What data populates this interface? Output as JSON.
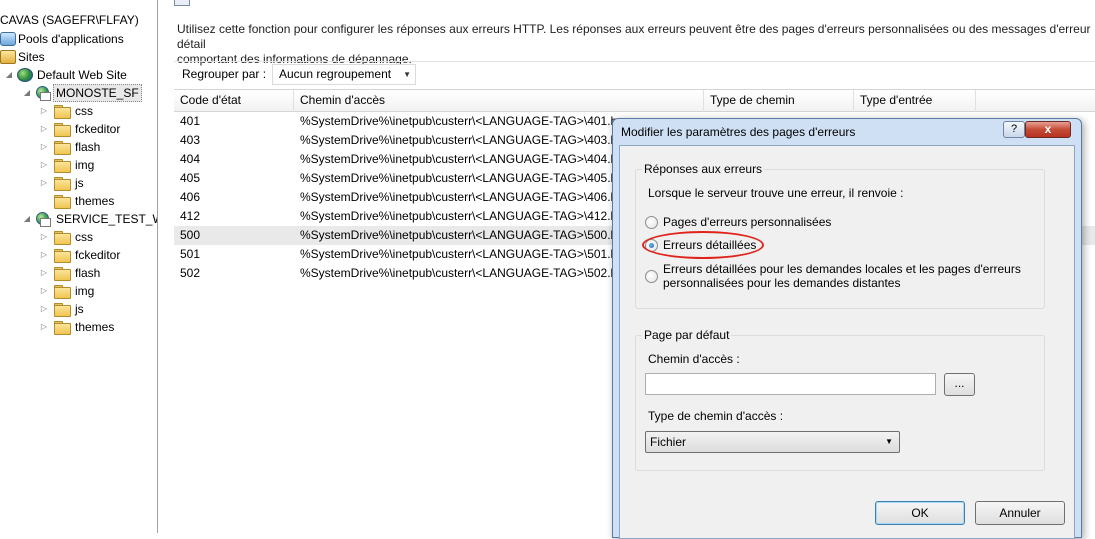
{
  "tree": {
    "items": [
      {
        "label": "CAVAS (SAGEFR\\FLFAY)",
        "icon": "server-icon"
      },
      {
        "label": "Pools d'applications",
        "icon": "app-pool-icon"
      },
      {
        "label": "Sites",
        "icon": "sites-icon"
      },
      {
        "label": "Default Web Site",
        "icon": "globe-icon"
      },
      {
        "label": "MONOSTE_SF",
        "icon": "site-icon"
      },
      {
        "label": "css",
        "icon": "folder-icon"
      },
      {
        "label": "fckeditor",
        "icon": "folder-icon"
      },
      {
        "label": "flash",
        "icon": "folder-icon"
      },
      {
        "label": "img",
        "icon": "folder-icon"
      },
      {
        "label": "js",
        "icon": "folder-icon"
      },
      {
        "label": "themes",
        "icon": "folder-icon"
      },
      {
        "label": "SERVICE_TEST_WSI",
        "icon": "site-icon"
      },
      {
        "label": "css",
        "icon": "folder-icon"
      },
      {
        "label": "fckeditor",
        "icon": "folder-icon"
      },
      {
        "label": "flash",
        "icon": "folder-icon"
      },
      {
        "label": "img",
        "icon": "folder-icon"
      },
      {
        "label": "js",
        "icon": "folder-icon"
      },
      {
        "label": "themes",
        "icon": "folder-icon"
      }
    ]
  },
  "main": {
    "description_line1": "Utilisez cette fonction pour configurer les réponses aux erreurs HTTP. Les réponses aux erreurs peuvent être des pages d'erreurs personnalisées ou des messages d'erreur détail",
    "description_line2": "comportant des informations de dépannage.",
    "group_by_label": "Regrouper par :",
    "group_by_value": "Aucun regroupement",
    "columns": [
      "Code d'état",
      "Chemin d'accès",
      "Type de chemin",
      "Type d'entrée"
    ],
    "rows": [
      {
        "code": "401",
        "path": "%SystemDrive%\\inetpub\\custerr\\<LANGUAGE-TAG>\\401.h"
      },
      {
        "code": "403",
        "path": "%SystemDrive%\\inetpub\\custerr\\<LANGUAGE-TAG>\\403.h"
      },
      {
        "code": "404",
        "path": "%SystemDrive%\\inetpub\\custerr\\<LANGUAGE-TAG>\\404.h"
      },
      {
        "code": "405",
        "path": "%SystemDrive%\\inetpub\\custerr\\<LANGUAGE-TAG>\\405.h"
      },
      {
        "code": "406",
        "path": "%SystemDrive%\\inetpub\\custerr\\<LANGUAGE-TAG>\\406.h"
      },
      {
        "code": "412",
        "path": "%SystemDrive%\\inetpub\\custerr\\<LANGUAGE-TAG>\\412.h"
      },
      {
        "code": "500",
        "path": "%SystemDrive%\\inetpub\\custerr\\<LANGUAGE-TAG>\\500.h"
      },
      {
        "code": "501",
        "path": "%SystemDrive%\\inetpub\\custerr\\<LANGUAGE-TAG>\\501.h"
      },
      {
        "code": "502",
        "path": "%SystemDrive%\\inetpub\\custerr\\<LANGUAGE-TAG>\\502.h"
      }
    ],
    "selected_row": "500"
  },
  "dialog": {
    "title": "Modifier les paramètres des pages d'erreurs",
    "help_label": "?",
    "close_label": "x",
    "responses_group_title": "Réponses aux erreurs",
    "responses_prompt": "Lorsque le serveur trouve une erreur, il renvoie :",
    "option_custom": "Pages d'erreurs personnalisées",
    "option_detailed": "Erreurs détaillées",
    "option_mixed_line1": "Erreurs détaillées pour les demandes locales et les pages d'erreurs",
    "option_mixed_line2": "personnalisées pour les demandes distantes",
    "selected_option": "Erreurs détaillées",
    "default_page_group_title": "Page par défaut",
    "path_label": "Chemin d'accès :",
    "path_value": "",
    "browse_label": "...",
    "path_type_label": "Type de chemin d'accès :",
    "path_type_value": "Fichier",
    "ok_label": "OK",
    "cancel_label": "Annuler"
  },
  "colors": {
    "dialog_frame": "#cfe0f4",
    "close_button": "#c44c37",
    "highlight_ellipse": "#e0241b",
    "selected_row": "#e9e9e9"
  }
}
